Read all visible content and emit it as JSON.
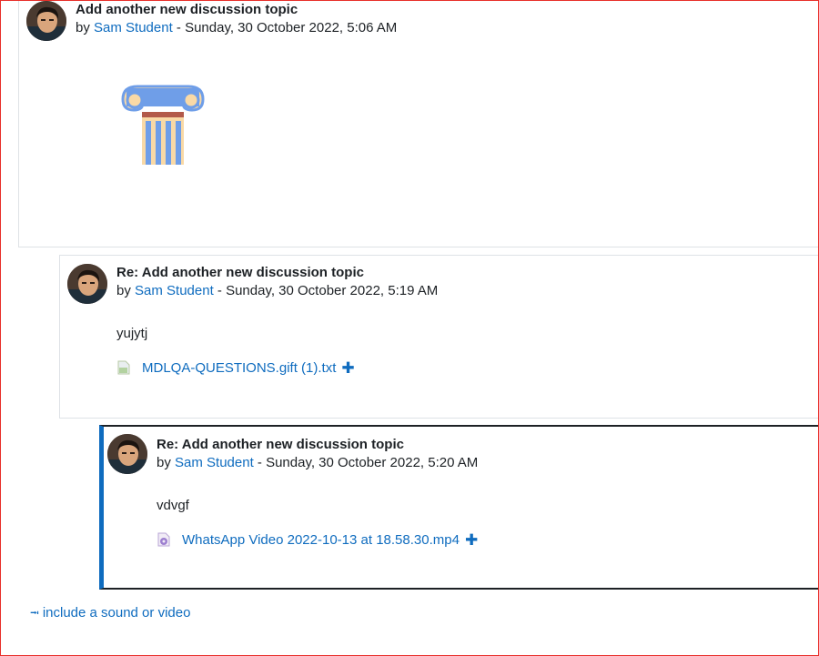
{
  "posts": [
    {
      "subject": "Add another new discussion topic",
      "by_prefix": "by ",
      "author": "Sam Student",
      "date_suffix": " - Sunday, 30 October 2022, 5:06 AM"
    },
    {
      "subject": "Re: Add another new discussion topic",
      "by_prefix": "by ",
      "author": "Sam Student",
      "date_suffix": " - Sunday, 30 October 2022, 5:19 AM",
      "content": "yujytj",
      "attachment": {
        "name": "MDLQA-QUESTIONS.gift (1).txt",
        "icon": "text-file-icon"
      }
    },
    {
      "subject": "Re: Add another new discussion topic",
      "by_prefix": "by ",
      "author": "Sam Student",
      "date_suffix": " - Sunday, 30 October 2022, 5:20 AM",
      "content": "vdvgf",
      "attachment": {
        "name": "WhatsApp Video 2022-10-13 at 18.58.30.mp4",
        "icon": "video-file-icon"
      }
    }
  ],
  "plus_symbol": "✚",
  "footer_link": {
    "arrow": "⭲",
    "label": "include a sound or video"
  },
  "colors": {
    "link": "#0f6cbf",
    "frame": "#e8302a",
    "selected_border": "#0f6cbf"
  }
}
